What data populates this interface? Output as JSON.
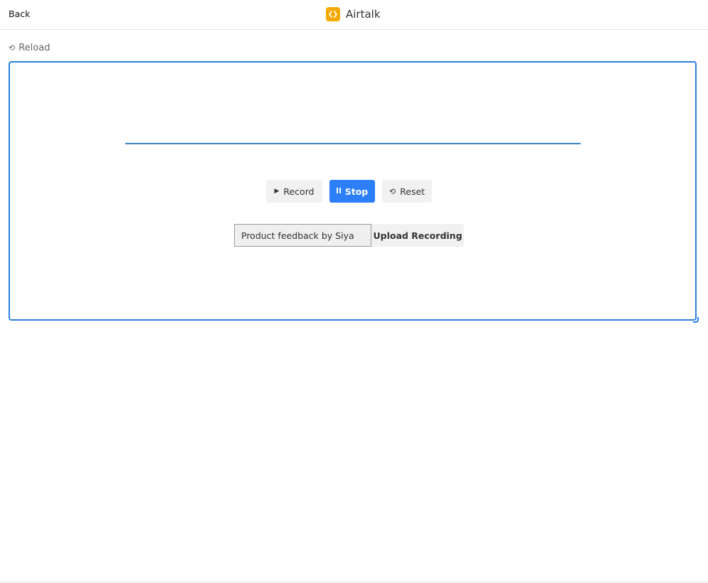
{
  "header": {
    "back_label": "Back",
    "app_title": "Airtalk",
    "logo_icon": "code-brackets-icon",
    "logo_color": "#f5a800"
  },
  "toolbar": {
    "reload_label": "Reload",
    "reload_icon": "reload-icon"
  },
  "recorder": {
    "accent_color": "#2d7ff9",
    "record_label": "Record",
    "record_icon": "play-icon",
    "stop_label": "Stop",
    "stop_icon": "pause-icon",
    "reset_label": "Reset",
    "reset_icon": "reset-icon",
    "recording_name_value": "Product feedback by Siya",
    "upload_label": "Upload Recording"
  }
}
